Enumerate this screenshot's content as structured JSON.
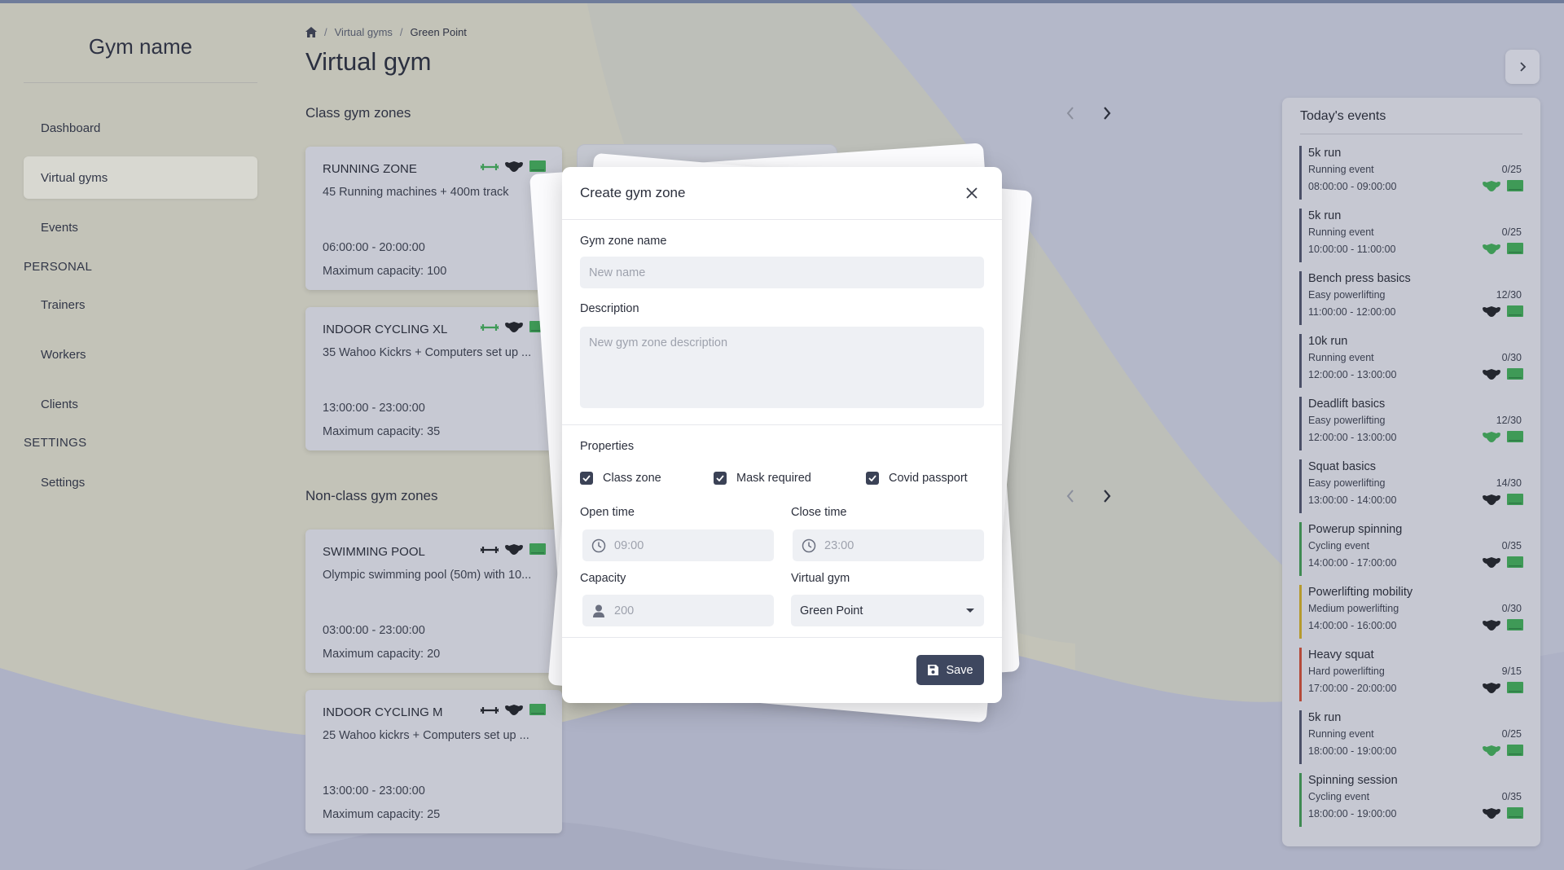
{
  "colors": {
    "background": "#b8bccb",
    "accent": "#3e475f",
    "green_icon": "#3f9a57",
    "dark_icon": "#24272f",
    "event_bars": [
      "#4b5068",
      "#4b5068",
      "#4b5068",
      "#4b5068",
      "#4b5068",
      "#4b5068",
      "#3f8a52",
      "#b59a2e",
      "#b44a3a",
      "#4b5068",
      "#3f8a52"
    ]
  },
  "sidebar": {
    "brand": "Gym name",
    "items": [
      {
        "label": "Dashboard"
      },
      {
        "label": "Virtual gyms",
        "active": true
      },
      {
        "label": "Events"
      }
    ],
    "section_personal": "PERSONAL",
    "personal_items": [
      {
        "label": "Trainers"
      },
      {
        "label": "Workers"
      },
      {
        "label": "Clients"
      }
    ],
    "section_settings": "SETTINGS",
    "settings_items": [
      {
        "label": "Settings"
      }
    ]
  },
  "breadcrumb": {
    "icon": "home-icon",
    "items": [
      "Virtual gyms",
      "Green Point"
    ],
    "separator": "/"
  },
  "page_title": "Virtual gym",
  "class_zones": {
    "title": "Class gym zones",
    "cards": [
      {
        "name": "RUNNING ZONE",
        "description": "45 Running machines + 400m track",
        "time": "06:00:00 - 20:00:00",
        "capacity": "Maximum capacity: 100",
        "icons": [
          "dumbbell-icon-green",
          "mask-icon",
          "passport-icon-green"
        ]
      },
      {
        "name": "INDOOR CYCLING XL",
        "description": "35 Wahoo Kickrs + Computers set up ...",
        "time": "13:00:00 - 23:00:00",
        "capacity": "Maximum capacity: 35",
        "icons": [
          "dumbbell-icon-green",
          "mask-icon",
          "passport-icon-green"
        ]
      }
    ]
  },
  "nonclass_zones": {
    "title": "Non-class gym zones",
    "cards": [
      {
        "name": "SWIMMING POOL",
        "description": "Olympic swimming pool (50m) with 10...",
        "time": "03:00:00 - 23:00:00",
        "capacity": "Maximum capacity: 20",
        "icons": [
          "dumbbell-icon",
          "mask-icon",
          "passport-icon-green"
        ]
      },
      {
        "name": "INDOOR CYCLING M",
        "description": "25 Wahoo kickrs + Computers set up ...",
        "time": "13:00:00 - 23:00:00",
        "capacity": "Maximum capacity: 25",
        "icons": [
          "dumbbell-icon",
          "mask-icon",
          "passport-icon-green"
        ]
      }
    ]
  },
  "events": {
    "title": "Today's events",
    "items": [
      {
        "name": "5k run",
        "type": "Running event",
        "count": "0/25",
        "time": "08:00:00 - 09:00:00",
        "mask_green": true
      },
      {
        "name": "5k run",
        "type": "Running event",
        "count": "0/25",
        "time": "10:00:00 - 11:00:00",
        "mask_green": true
      },
      {
        "name": "Bench press basics",
        "type": "Easy powerlifting",
        "count": "12/30",
        "time": "11:00:00 - 12:00:00",
        "mask_green": false
      },
      {
        "name": "10k run",
        "type": "Running event",
        "count": "0/30",
        "time": "12:00:00 - 13:00:00",
        "mask_green": false
      },
      {
        "name": "Deadlift basics",
        "type": "Easy powerlifting",
        "count": "12/30",
        "time": "12:00:00 - 13:00:00",
        "mask_green": true
      },
      {
        "name": "Squat basics",
        "type": "Easy powerlifting",
        "count": "14/30",
        "time": "13:00:00 - 14:00:00",
        "mask_green": false
      },
      {
        "name": "Powerup spinning",
        "type": "Cycling event",
        "count": "0/35",
        "time": "14:00:00 - 17:00:00",
        "mask_green": false
      },
      {
        "name": "Powerlifting mobility",
        "type": "Medium powerlifting",
        "count": "0/30",
        "time": "14:00:00 - 16:00:00",
        "mask_green": false
      },
      {
        "name": "Heavy squat",
        "type": "Hard powerlifting",
        "count": "9/15",
        "time": "17:00:00 - 20:00:00",
        "mask_green": false
      },
      {
        "name": "5k run",
        "type": "Running event",
        "count": "0/25",
        "time": "18:00:00 - 19:00:00",
        "mask_green": true
      },
      {
        "name": "Spinning session",
        "type": "Cycling event",
        "count": "0/35",
        "time": "18:00:00 - 19:00:00",
        "mask_green": false
      }
    ]
  },
  "modal": {
    "title": "Create gym zone",
    "name_label": "Gym zone name",
    "name_placeholder": "New name",
    "description_label": "Description",
    "description_placeholder": "New gym zone description",
    "properties_label": "Properties",
    "checks": [
      {
        "label": "Class zone",
        "checked": true
      },
      {
        "label": "Mask required",
        "checked": true
      },
      {
        "label": "Covid passport",
        "checked": true
      }
    ],
    "open_time_label": "Open time",
    "open_time_placeholder": "09:00",
    "close_time_label": "Close time",
    "close_time_placeholder": "23:00",
    "capacity_label": "Capacity",
    "capacity_placeholder": "200",
    "virtual_gym_label": "Virtual gym",
    "virtual_gym_value": "Green Point",
    "save_label": "Save"
  }
}
